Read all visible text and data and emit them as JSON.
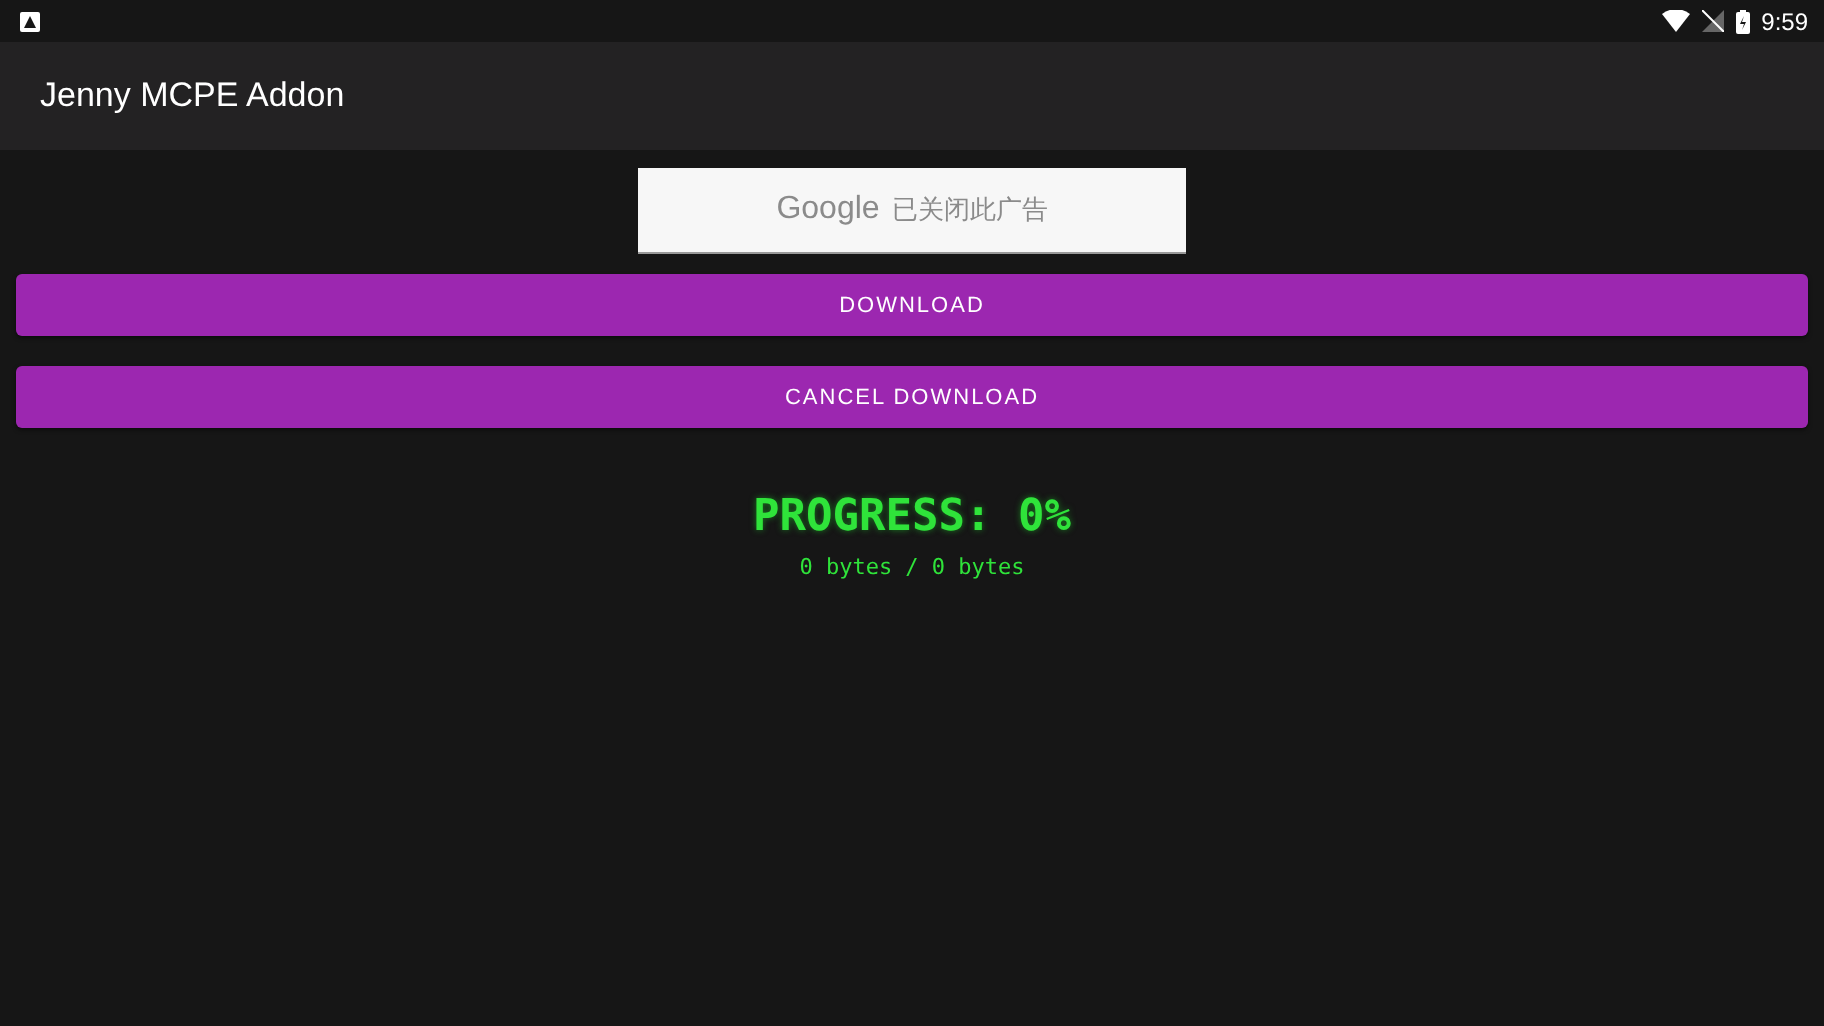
{
  "status_bar": {
    "time": "9:59"
  },
  "app_bar": {
    "title": "Jenny MCPE Addon"
  },
  "ad_banner": {
    "brand": "Google",
    "message": "已关闭此广告"
  },
  "buttons": [
    {
      "label": "DOWNLOAD"
    },
    {
      "label": "CANCEL DOWNLOAD"
    }
  ],
  "progress": {
    "title": "PROGRESS: 0%",
    "bytes": "0 bytes / 0 bytes"
  }
}
